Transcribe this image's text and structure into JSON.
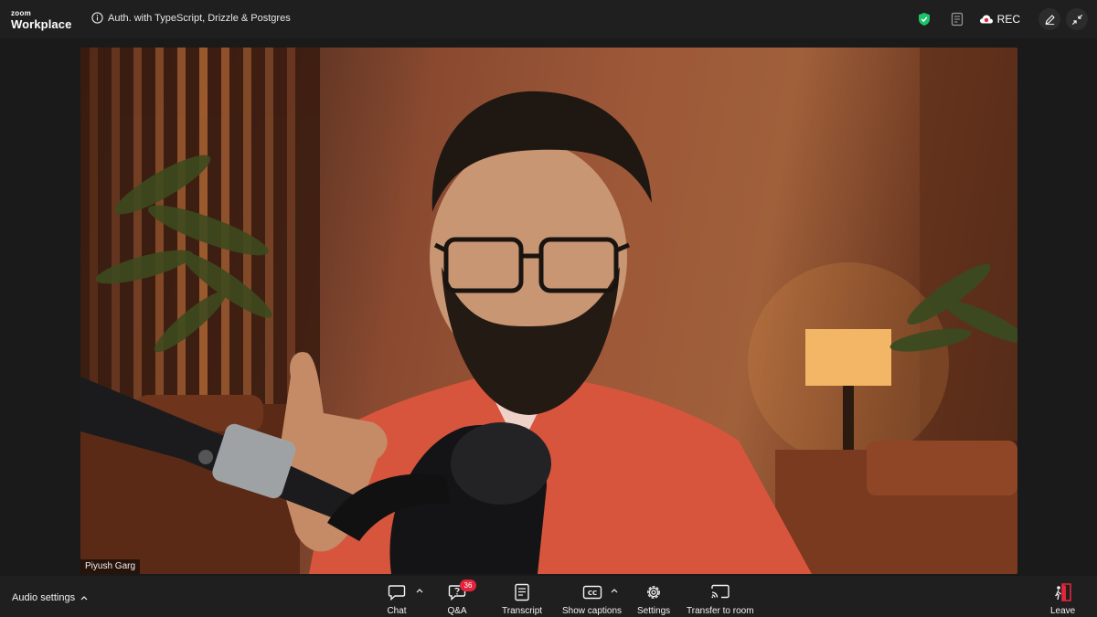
{
  "app": {
    "logo_small": "zoom",
    "logo_big": "Workplace"
  },
  "meeting": {
    "title": "Auth. with TypeScript, Drizzle & Postgres",
    "rec_label": "REC",
    "participant_name": "Piyush Garg"
  },
  "toolbar": {
    "audio_settings": "Audio settings",
    "chat": "Chat",
    "qa": "Q&A",
    "qa_badge": "36",
    "transcript": "Transcript",
    "captions": "Show captions",
    "settings": "Settings",
    "transfer": "Transfer to room",
    "leave": "Leave"
  },
  "icons": {
    "info": "info-icon",
    "shield": "shield-check-icon",
    "notes": "notes-icon",
    "rec": "cloud-record-icon",
    "pen": "pen-icon",
    "minimize": "minimize-icon",
    "chat": "chat-bubble-icon",
    "qa": "question-bubble-icon",
    "transcript": "transcript-icon",
    "captions": "closed-captions-icon",
    "settings": "gear-icon",
    "transfer": "cast-icon",
    "leave": "leave-door-icon"
  },
  "colors": {
    "topbar_bg": "#1f1f1f",
    "toolbar_bg": "#1f1f1f",
    "shield_green": "#1ec46a",
    "badge_red": "#e0253c",
    "leave_red": "#e0253c"
  }
}
